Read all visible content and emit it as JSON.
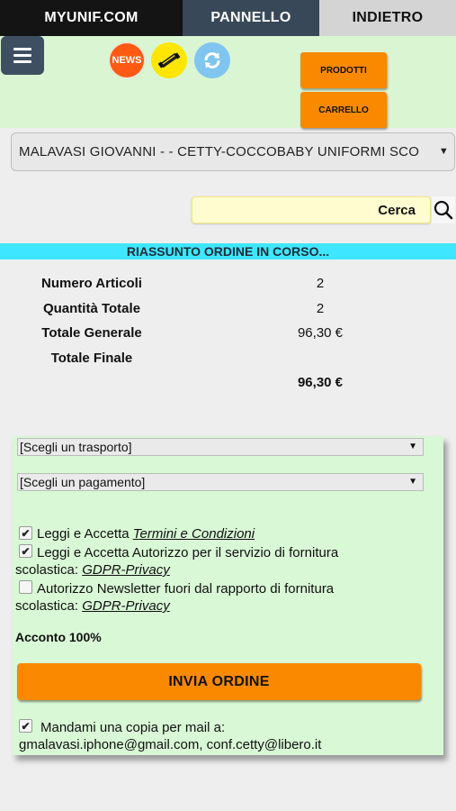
{
  "tabs": [
    {
      "label": "MYUNIF.COM"
    },
    {
      "label": "PANNELLO"
    },
    {
      "label": "INDIETRO"
    }
  ],
  "header": {
    "news_label": "NEWS",
    "prodotti_label": "PRODOTTI",
    "carrello_label": "CARRELLO"
  },
  "customer": {
    "selected": "MALAVASI GIOVANNI - - CETTY-COCCOBABY UNIFORMI SCO"
  },
  "search": {
    "label": "Cerca"
  },
  "summary": {
    "title": "RIASSUNTO ORDINE IN CORSO...",
    "rows": [
      {
        "label": "Numero Articoli",
        "value": "2"
      },
      {
        "label": "Quantità Totale",
        "value": "2"
      },
      {
        "label": "Totale Generale",
        "value": "96,30 €"
      },
      {
        "label": "Totale Finale",
        "value": ""
      }
    ],
    "final_value": "96,30 €"
  },
  "form": {
    "transport": "[Scegli un trasporto]",
    "payment": "[Scegli un pagamento]",
    "terms": {
      "prefix": "Leggi e Accetta ",
      "link": "Termini e Condizioni",
      "checked": true
    },
    "gdpr": {
      "line1": "Leggi e Accetta  Autorizzo per il servizio di fornitura",
      "line2_prefix": "scolastica: ",
      "link": "GDPR-Privacy",
      "checked": true
    },
    "newsletter": {
      "line1": "Autorizzo Newsletter fuori dal rapporto di fornitura",
      "line2_prefix": "scolastica: ",
      "link": "GDPR-Privacy",
      "checked": false
    },
    "acconto": "Acconto 100%",
    "submit_label": "INVIA ORDINE",
    "mail_copy": {
      "line1": "Mandami una copia per mail a:",
      "line2": "gmalavasi.iphone@gmail.com, conf.cetty@libero.it",
      "checked": true
    }
  },
  "colors": {
    "accent_orange": "#fa8900",
    "header_green": "#d9f5d2",
    "banner_cyan": "#3fe6ff"
  }
}
